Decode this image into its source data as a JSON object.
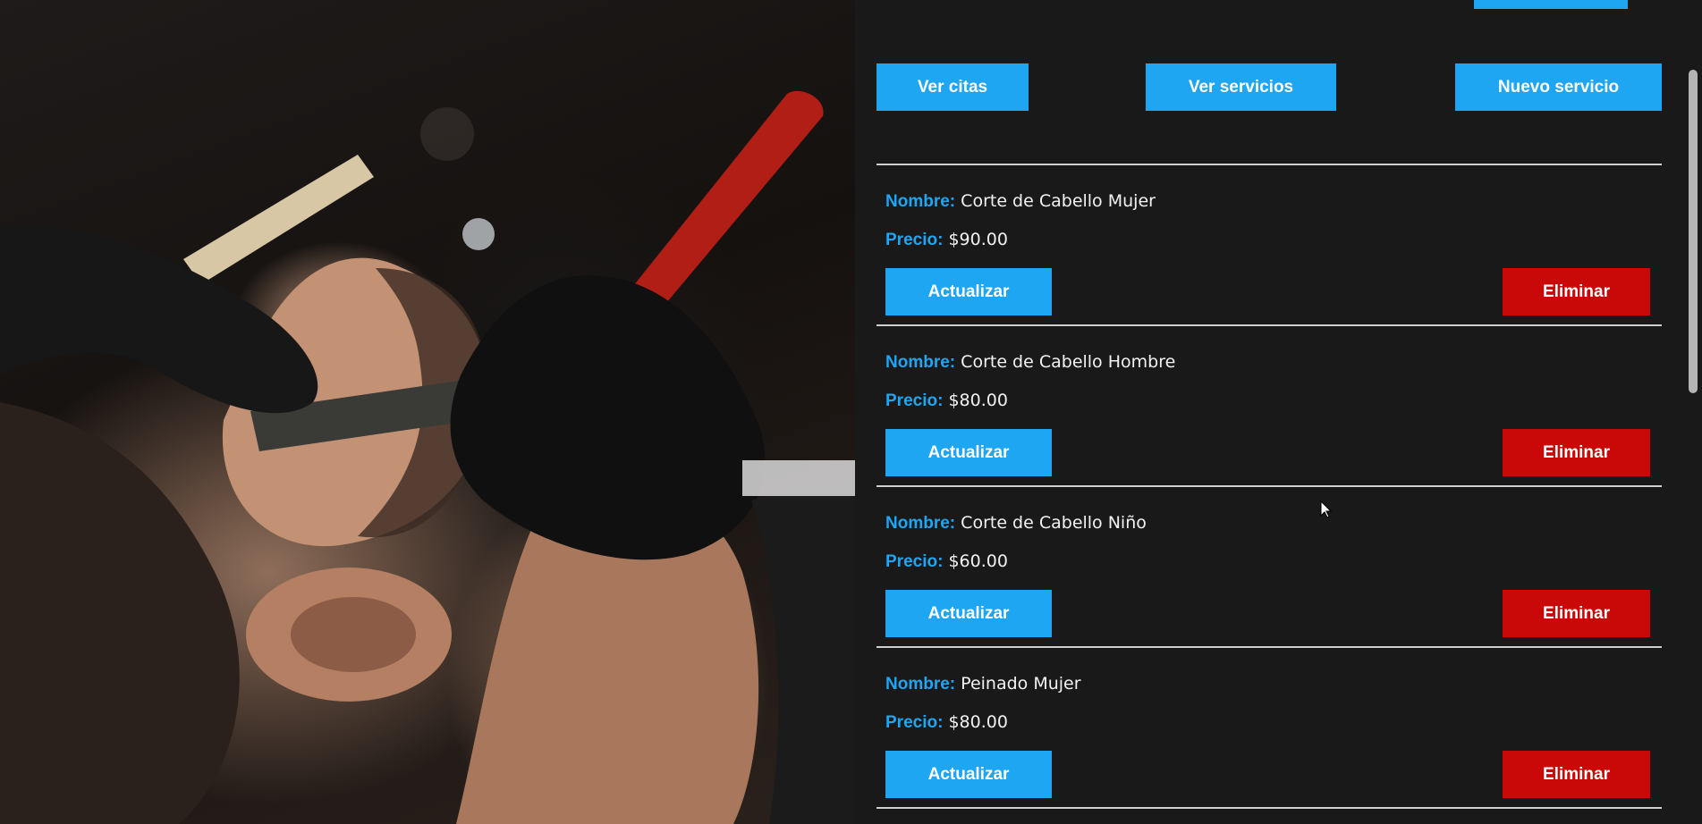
{
  "hero": {
    "image_description_name": "barber-shaving-photo"
  },
  "nav": {
    "citas": "Ver citas",
    "servicios": "Ver servicios",
    "nuevo": "Nuevo servicio"
  },
  "labels": {
    "name": "Nombre:",
    "price": "Precio:",
    "update": "Actualizar",
    "delete": "Eliminar"
  },
  "services": [
    {
      "name": "Corte de Cabello Mujer",
      "price": "$90.00"
    },
    {
      "name": "Corte de Cabello Hombre",
      "price": "$80.00"
    },
    {
      "name": "Corte de Cabello Niño",
      "price": "$60.00"
    },
    {
      "name": "Peinado Mujer",
      "price": "$80.00"
    }
  ],
  "colors": {
    "accent": "#1ea6f2",
    "danger": "#c90808",
    "background": "#1a1919"
  }
}
